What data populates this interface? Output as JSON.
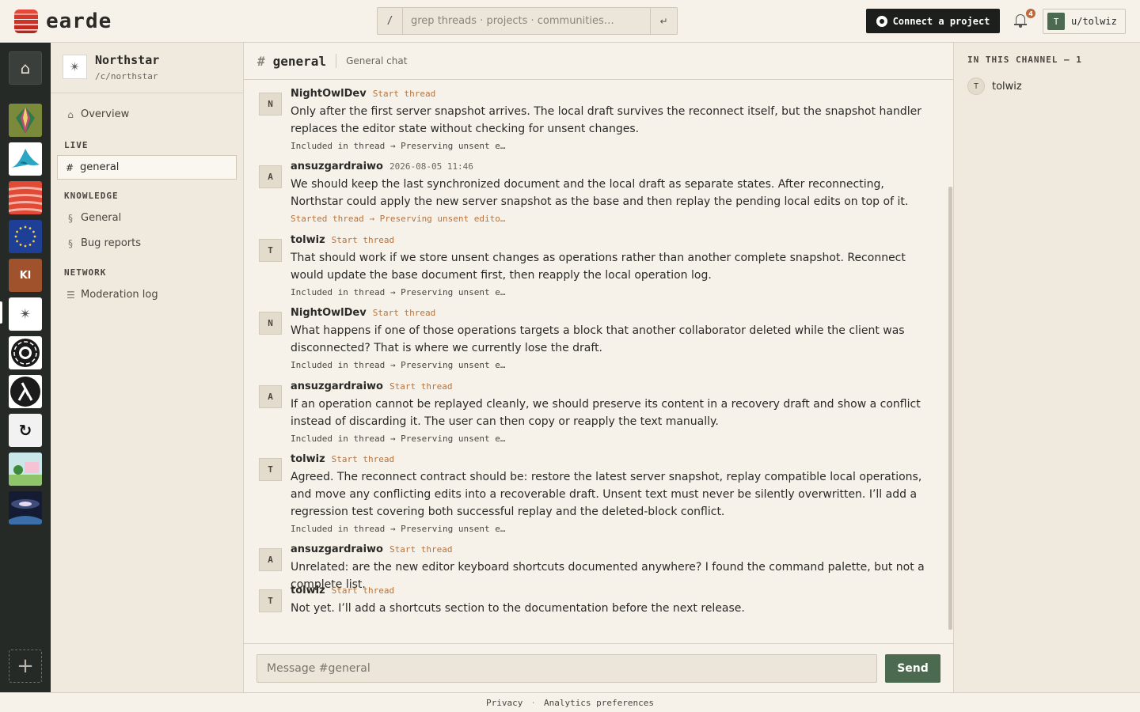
{
  "app": {
    "name": "earde"
  },
  "search": {
    "slash": "/",
    "placeholder": "grep threads · projects · communities…",
    "enter_glyph": "↵"
  },
  "header": {
    "connect_label": "Connect a project",
    "notifications_count": "4",
    "user_initial": "T",
    "user_label": "u/tolwiz"
  },
  "rail": {
    "home_icon": "home-icon",
    "communities": [
      {
        "name": "crystal-community",
        "color": "#6a8a3a"
      },
      {
        "name": "mountain-community",
        "color": "#ffffff"
      },
      {
        "name": "earde-community",
        "color": "#d23a2c"
      },
      {
        "name": "eu-community",
        "color": "#1f3f97"
      },
      {
        "name": "kl-community",
        "label": "Kl",
        "color": "#a0522d"
      },
      {
        "name": "northstar-community",
        "color": "#ffffff"
      },
      {
        "name": "aperture-community",
        "color": "#ffffff"
      },
      {
        "name": "lambda-community",
        "color": "#1b1b1b"
      },
      {
        "name": "cycle-community",
        "color": "#ffffff"
      },
      {
        "name": "good-day-community",
        "label": "You will have a GOOD DAY That's a threat!",
        "color": "#c9e6e8"
      },
      {
        "name": "galaxy-community",
        "color": "#1d2a45"
      }
    ],
    "add_icon": "plus-icon"
  },
  "community": {
    "logo": "✴",
    "name": "Northstar",
    "slug": "/c/northstar"
  },
  "sidebar": {
    "overview": {
      "icon": "⌂",
      "label": "Overview"
    },
    "live_label": "LIVE",
    "live": [
      {
        "icon": "#",
        "label": "general"
      }
    ],
    "knowledge_label": "KNOWLEDGE",
    "knowledge": [
      {
        "icon": "§",
        "label": "General"
      },
      {
        "icon": "§",
        "label": "Bug reports"
      }
    ],
    "network_label": "NETWORK",
    "network": [
      {
        "icon": "☰",
        "label": "Moderation log"
      }
    ]
  },
  "channel": {
    "hash": "#",
    "name": "general",
    "description": "General chat"
  },
  "messages": [
    {
      "avatar": "N",
      "author": "NightOwlDev",
      "action": "Start thread",
      "text": "Only after the first server snapshot arrives. The local draft survives the reconnect itself, but the snapshot handler replaces the editor state without checking for unsent changes.",
      "thread": "Included in thread → Preserving unsent e…"
    },
    {
      "avatar": "A",
      "author": "ansuzgardraiwo",
      "time": "2026-08-05 11:46",
      "text": "We should keep the last synchronized document and the local draft as separate states. After reconnecting, Northstar could apply the new server snapshot as the base and then replay the pending local edits on top of it.",
      "thread": "Started thread → Preserving unsent edito…"
    },
    {
      "avatar": "T",
      "author": "tolwiz",
      "action": "Start thread",
      "text": "That should work if we store unsent changes as operations rather than another complete snapshot. Reconnect would update the base document first, then reapply the local operation log.",
      "thread": "Included in thread → Preserving unsent e…"
    },
    {
      "avatar": "N",
      "author": "NightOwlDev",
      "action": "Start thread",
      "text": "What happens if one of those operations targets a block that another collaborator deleted while the client was disconnected? That is where we currently lose the draft.",
      "thread": "Included in thread → Preserving unsent e…"
    },
    {
      "avatar": "A",
      "author": "ansuzgardraiwo",
      "action": "Start thread",
      "text": "If an operation cannot be replayed cleanly, we should preserve its content in a recovery draft and show a conflict instead of discarding it. The user can then copy or reapply the text manually.",
      "thread": "Included in thread → Preserving unsent e…"
    },
    {
      "avatar": "T",
      "author": "tolwiz",
      "action": "Start thread",
      "text": "Agreed. The reconnect contract should be: restore the latest server snapshot, replay compatible local operations, and move any conflicting edits into a recoverable draft. Unsent text must never be silently overwritten. I’ll add a regression test covering both successful replay and the deleted-block conflict.",
      "thread": "Included in thread → Preserving unsent e…"
    },
    {
      "avatar": "A",
      "author": "ansuzgardraiwo",
      "action": "Start thread",
      "text": "Unrelated: are the new editor keyboard shortcuts documented anywhere? I found the command palette, but not a complete list."
    },
    {
      "avatar": "T",
      "author": "tolwiz",
      "action": "Start thread",
      "text": "Not yet. I’ll add a shortcuts section to the documentation before the next release."
    }
  ],
  "composer": {
    "placeholder": "Message #general",
    "send_label": "Send"
  },
  "members": {
    "label": "IN THIS CHANNEL — 1",
    "list": [
      {
        "initial": "T",
        "name": "tolwiz"
      }
    ]
  },
  "footer": {
    "privacy": "Privacy",
    "separator": "·",
    "analytics": "Analytics preferences"
  }
}
